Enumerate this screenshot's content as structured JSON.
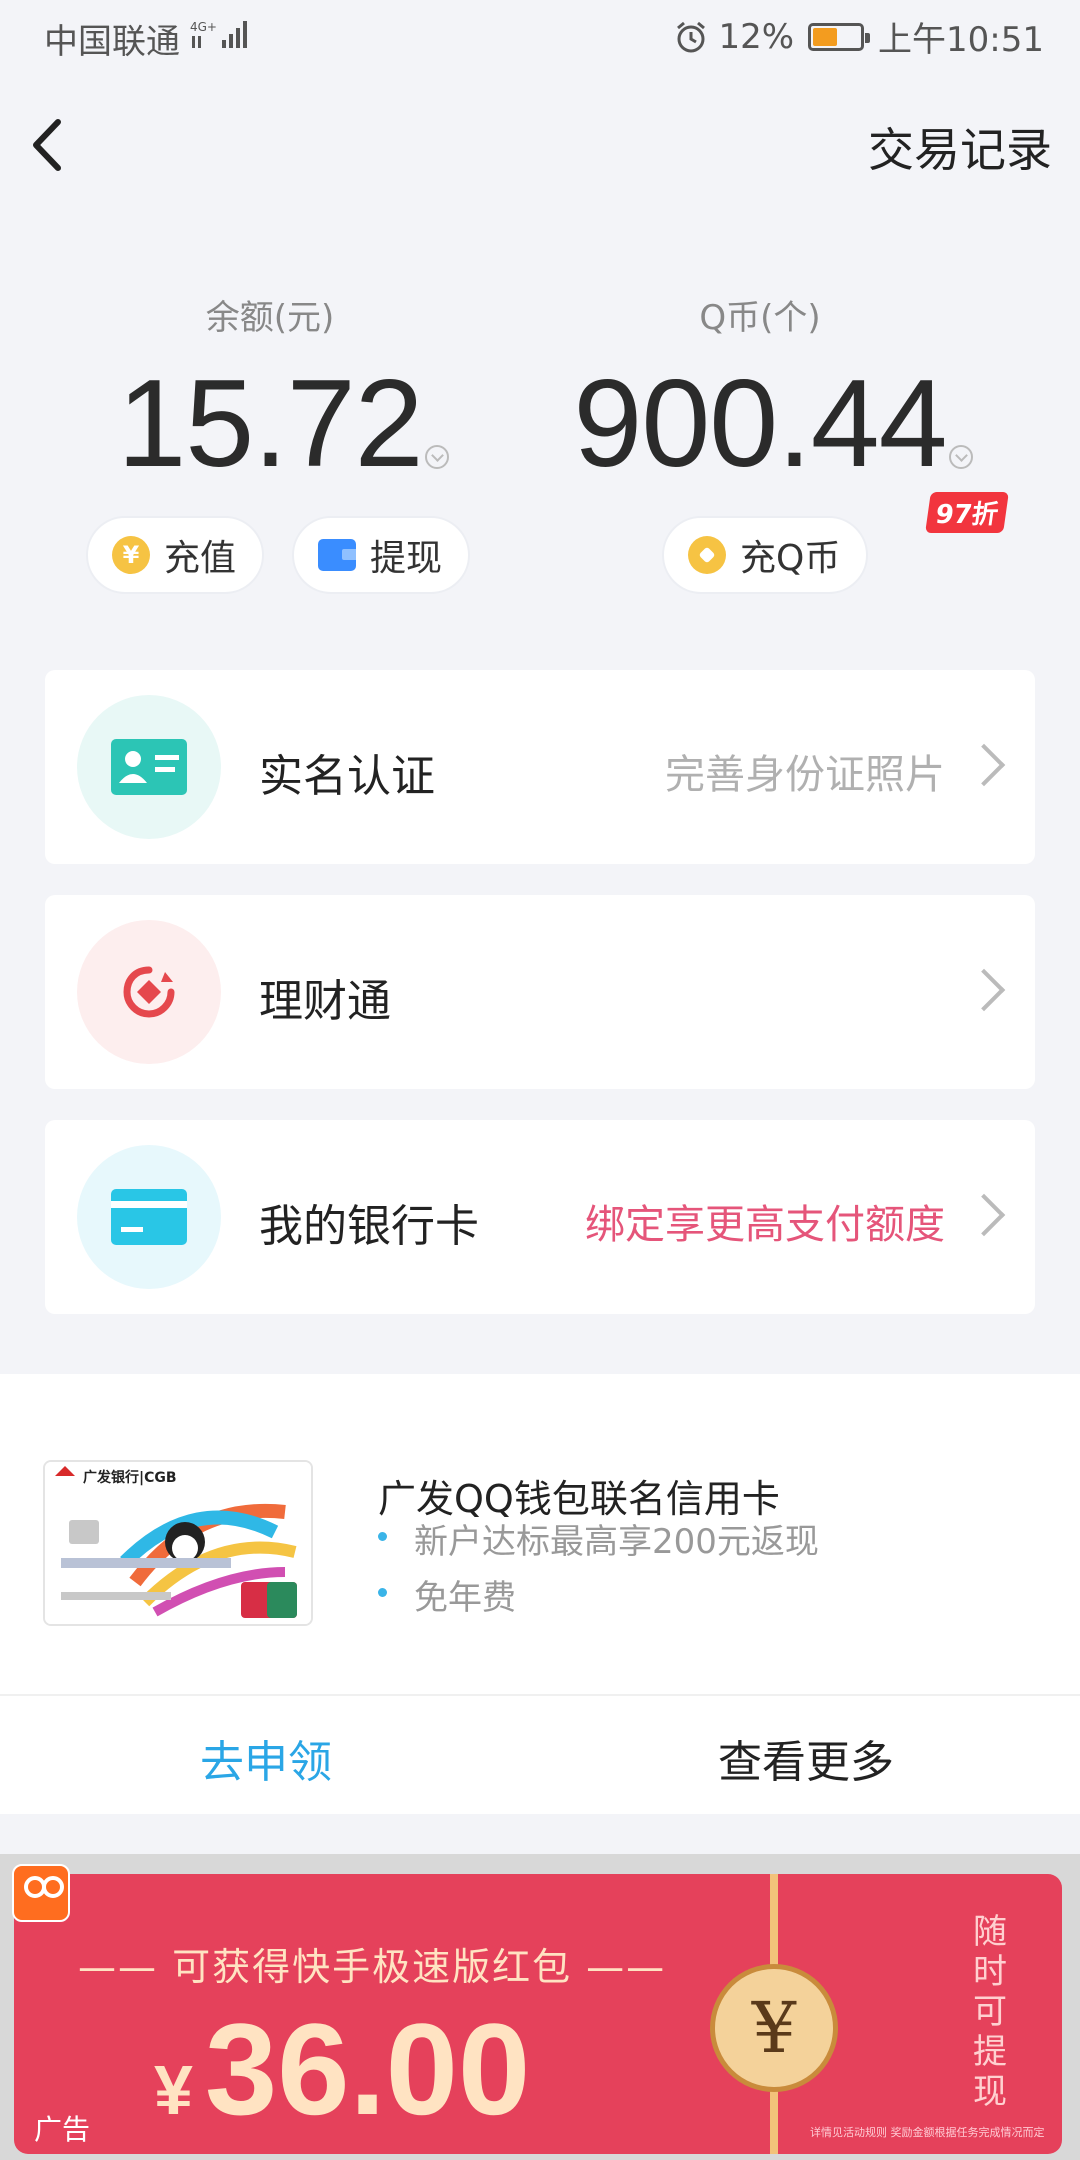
{
  "status_bar": {
    "carrier": "中国联通",
    "network": "4G+",
    "battery_percent": "12%",
    "time": "上午10:51"
  },
  "header": {
    "right_link": "交易记录"
  },
  "balances": {
    "balance": {
      "label": "余额(元)",
      "value": "15.72"
    },
    "qcoin": {
      "label": "Q币(个)",
      "value": "900.44"
    }
  },
  "actions": {
    "recharge": "充值",
    "withdraw": "提现",
    "recharge_qcoin": "充Q币",
    "discount_badge": "97折"
  },
  "menu": [
    {
      "title": "实名认证",
      "desc": "完善身份证照片",
      "desc_color": "#b0b0b0",
      "icon": "id-card-icon"
    },
    {
      "title": "理财通",
      "desc": "",
      "desc_color": "#b0b0b0",
      "icon": "wealth-icon"
    },
    {
      "title": "我的银行卡",
      "desc": "绑定享更高支付额度",
      "desc_color": "#e5557a",
      "icon": "bank-card-icon"
    }
  ],
  "promo": {
    "card_image_text": "广发银行|CGB",
    "title": "广发QQ钱包联名信用卡",
    "bullets": [
      "新户达标最高享200元返现",
      "免年费"
    ],
    "apply_button": "去申领",
    "more_button": "查看更多"
  },
  "ad": {
    "headline": "—— 可获得快手极速版红包 ——",
    "currency": "¥",
    "amount": "36.00",
    "vertical_text": "随时可提现",
    "fine_print": "详情见活动规则  奖励金额根据任务完成情况而定",
    "label": "广告"
  },
  "colors": {
    "accent_blue": "#2aa6e6",
    "pink_text": "#e5557a",
    "ad_red": "#e5415b"
  }
}
